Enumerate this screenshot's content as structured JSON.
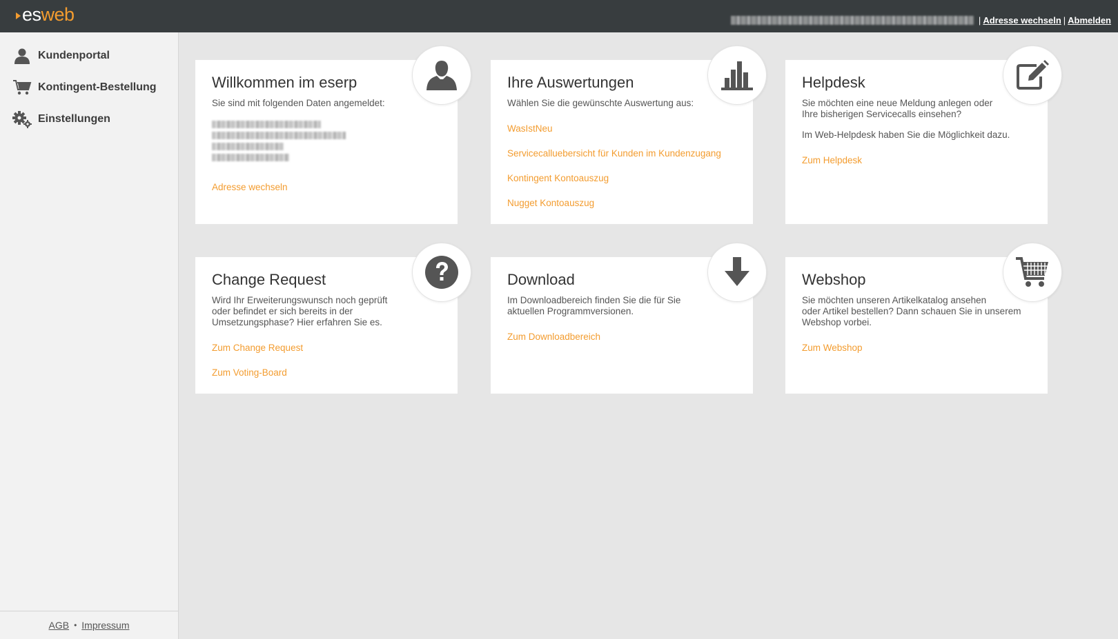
{
  "header": {
    "logo_es": "es",
    "logo_web": "web",
    "separator": "|",
    "change_address": "Adresse wechseln",
    "logout": "Abmelden"
  },
  "sidebar": {
    "items": [
      {
        "label": "Kundenportal",
        "icon": "user-icon"
      },
      {
        "label": "Kontingent-Bestellung",
        "icon": "cart-icon"
      },
      {
        "label": "Einstellungen",
        "icon": "gears-icon"
      }
    ],
    "footer": {
      "agb": "AGB",
      "dot": "•",
      "impressum": "Impressum"
    }
  },
  "cards": {
    "welcome": {
      "title": "Willkommen im eserp",
      "text": "Sie sind mit folgenden Daten angemeldet:",
      "link": "Adresse wechseln",
      "icon": "user-icon"
    },
    "reports": {
      "title": "Ihre Auswertungen",
      "text": "Wählen Sie die gewünschte Auswertung aus:",
      "links": [
        "WasIstNeu",
        "Servicecalluebersicht für Kunden im Kundenzugang",
        "Kontingent Kontoauszug",
        "Nugget Kontoauszug"
      ],
      "icon": "bar-chart-icon"
    },
    "helpdesk": {
      "title": "Helpdesk",
      "text1": "Sie möchten eine neue Meldung anlegen oder",
      "text2": "Ihre bisherigen Servicecalls einsehen?",
      "text3": "Im Web-Helpdesk haben Sie die Möglichkeit dazu.",
      "link": "Zum Helpdesk",
      "icon": "edit-icon"
    },
    "change_request": {
      "title": "Change Request",
      "text1": "Wird Ihr Erweiterungswunsch noch geprüft",
      "text2": "oder befindet er sich bereits in der",
      "text3": "Umsetzungsphase? Hier erfahren Sie es.",
      "link1": "Zum Change Request",
      "link2": "Zum Voting-Board",
      "icon": "question-icon"
    },
    "download": {
      "title": "Download",
      "text1": "Im Downloadbereich finden Sie die für Sie",
      "text2": "aktuellen Programmversionen.",
      "link": "Zum Downloadbereich",
      "icon": "download-arrow-icon"
    },
    "webshop": {
      "title": "Webshop",
      "text1": "Sie möchten unseren Artikelkatalog ansehen",
      "text2": "oder Artikel bestellen? Dann schauen Sie in unserem",
      "text3": "Webshop vorbei.",
      "link": "Zum Webshop",
      "icon": "cart-icon"
    }
  },
  "colors": {
    "header_bg": "#383d3f",
    "accent": "#f39c2f",
    "background": "#e6e6e6",
    "sidebar_bg": "#f2f2f2"
  }
}
